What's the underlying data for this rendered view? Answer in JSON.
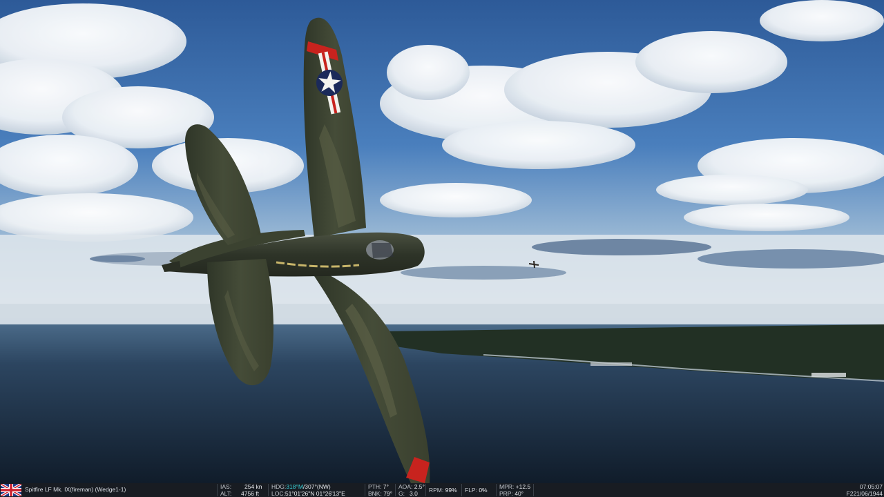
{
  "scene": {
    "player_aircraft": "spitfire",
    "national_marking": "us-star-roundel",
    "distant_aircraft": "enemy-fighter",
    "colors": {
      "sky_top": "#2f5f9e",
      "sky_horizon": "#c9d9e6",
      "sea": "#1d2d3e",
      "airframe": "#3d4430",
      "airframe_camo": "#5d6248",
      "roundel_red": "#c8231e"
    }
  },
  "hud": {
    "nation_flag": "uk-flag-icon",
    "aircraft_label": "Spitfire LF Mk. IX(fireman) (Wedge1-1)",
    "ias_label": "IAS:",
    "ias_value": "254 kn",
    "alt_label": "ALT:",
    "alt_value": "4756 ft",
    "hdg_label": "HDG:",
    "hdg_mag": "318°M",
    "hdg_true": "/307°(NW)",
    "loc_label": "LOC:",
    "loc_value": "51°01'26\"N 01°26'13\"E",
    "pth_label": "PTH:",
    "pth_value": "7°",
    "bnk_label": "BNK:",
    "bnk_value": "79°",
    "aoa_label": "AOA:",
    "aoa_value": "2.5°",
    "g_label": "G:",
    "g_value": "3.0",
    "rpm_label": "RPM:",
    "rpm_value": "99%",
    "flp_label": "FLP:",
    "flp_value": "0%",
    "mpr_label": "MPR:",
    "mpr_value": "+12.5",
    "prp_label": "PRP:",
    "prp_value": "40°",
    "time": "07:05:07",
    "date": "F221/06/1944"
  }
}
